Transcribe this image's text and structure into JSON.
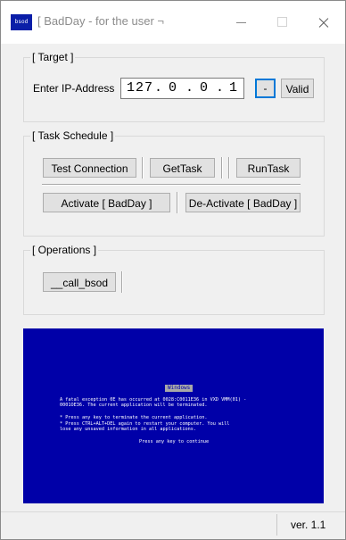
{
  "window": {
    "title": "[ BadDay - for the user ¬",
    "icon_text": "bsod"
  },
  "target": {
    "legend": "[ Target ]",
    "ip_label": "Enter IP-Address",
    "ip_octets": [
      "127",
      "0",
      "0",
      "1"
    ],
    "dash_button": "-",
    "valid_button": "Valid"
  },
  "task_schedule": {
    "legend": "[ Task Schedule ]",
    "test_connection": "Test Connection",
    "get_task": "GetTask",
    "run_task": "RunTask",
    "activate": "Activate [ BadDay ]",
    "deactivate": "De-Activate [ BadDay ]"
  },
  "operations": {
    "legend": "[ Operations ]",
    "call_bsod": "__call_bsod"
  },
  "bsod_preview": {
    "title": "Windows",
    "lines": [
      "A fatal exception 0E has occurred at 0028:C0011E36 in VXD VMM(01) -",
      "0001OE36. The current application will be terminated.",
      "*   Press any key to terminate the current application.",
      "*   Press CTRL+ALT+DEL again to restart your computer. You will",
      "    lose any unsaved information in all applications.",
      "Press any key to continue"
    ],
    "colors": {
      "background": "#0000a8",
      "text": "#ffffff"
    }
  },
  "status": {
    "version": "ver. 1.1"
  }
}
